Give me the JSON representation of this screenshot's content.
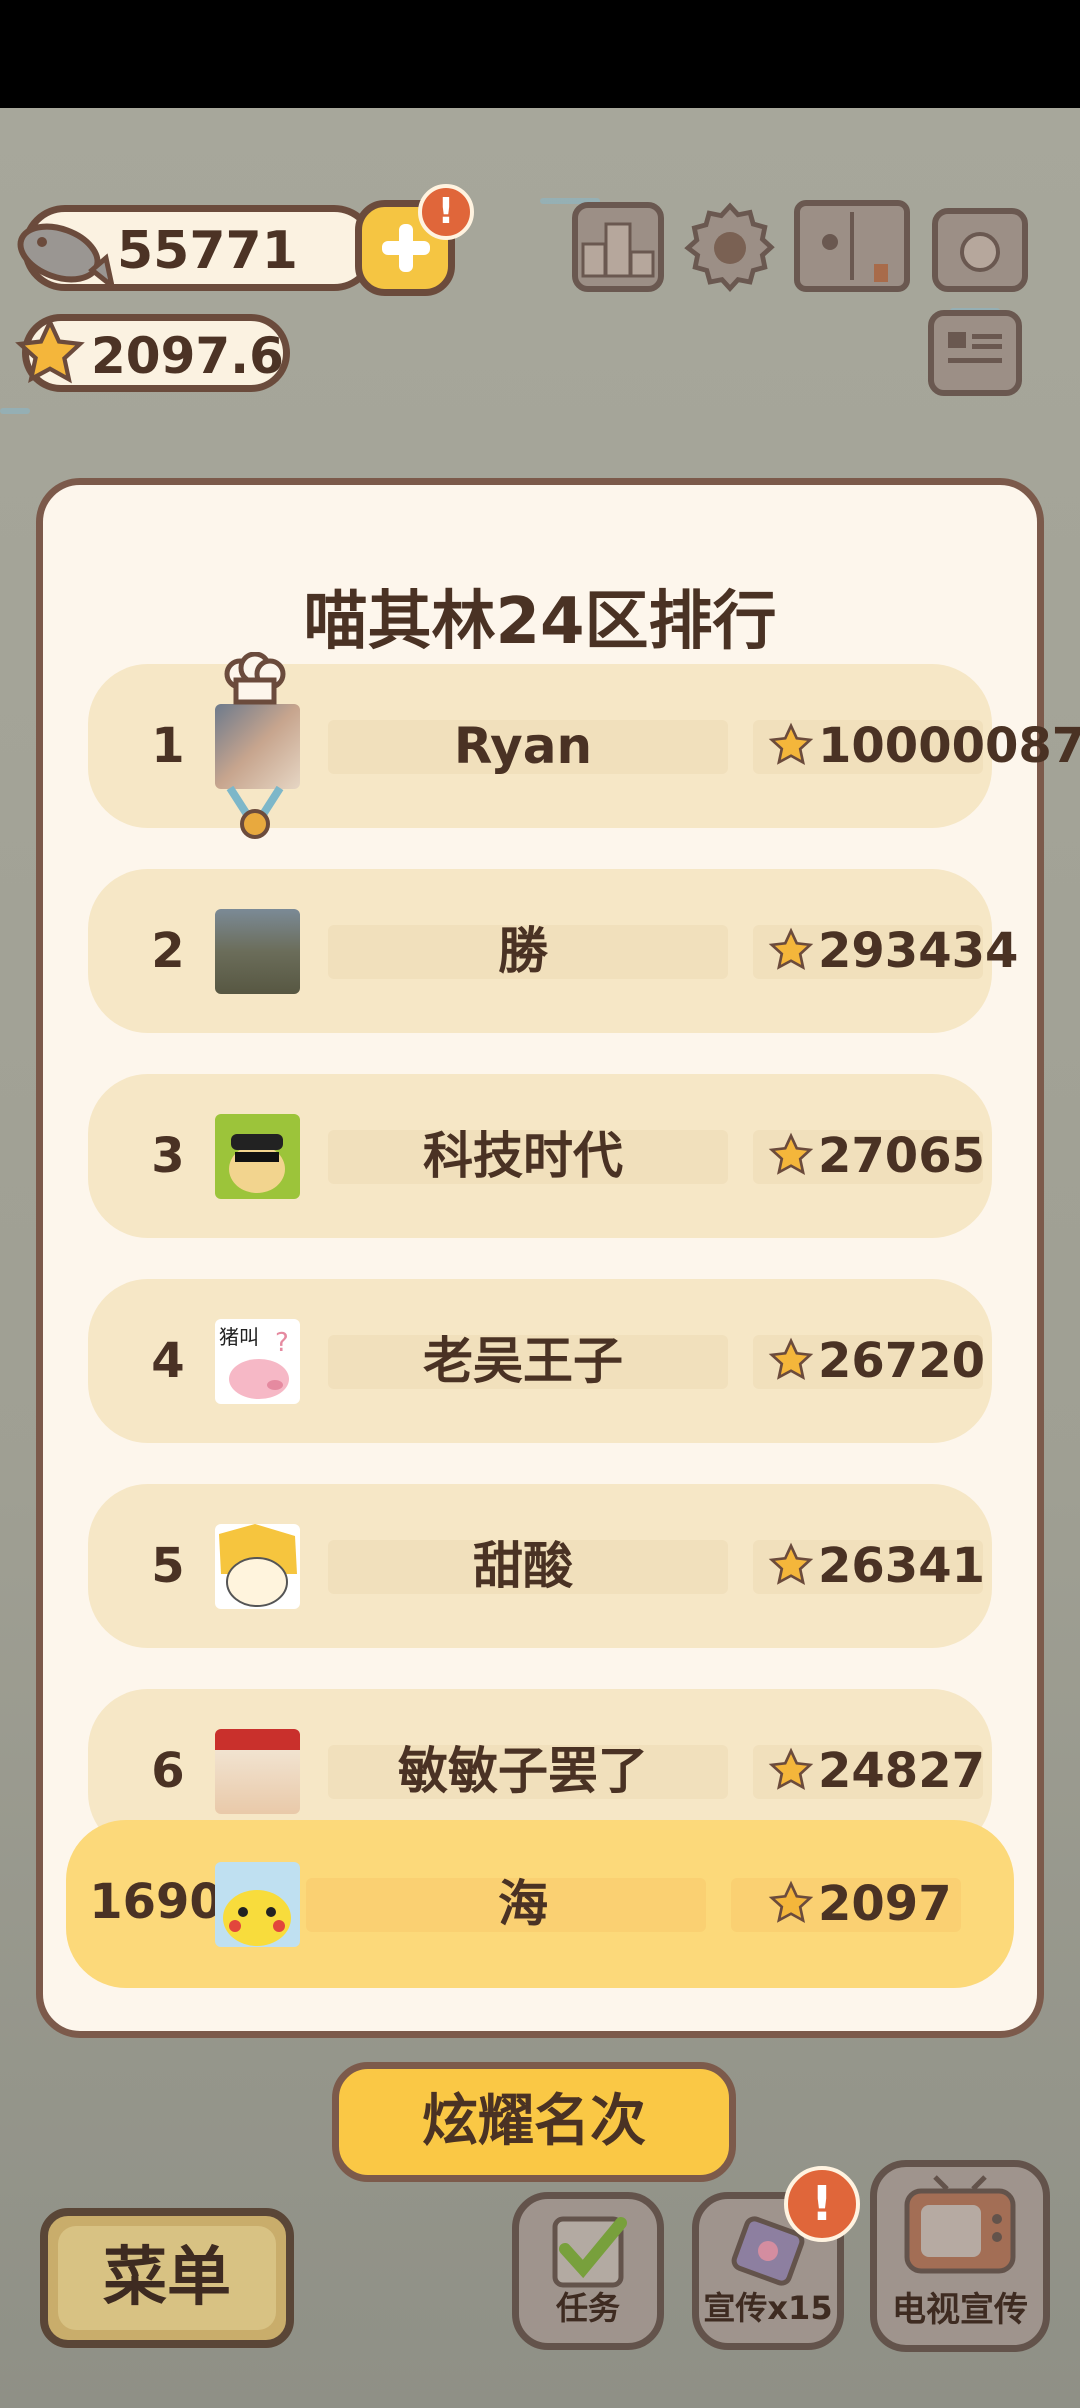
{
  "currency": {
    "fish": "55771",
    "stars": "2097.6",
    "plus_badge": "!"
  },
  "leaderboard": {
    "title": "喵其林24区排行",
    "rows": [
      {
        "rank": "1",
        "name": "Ryan",
        "score": "10000087"
      },
      {
        "rank": "2",
        "name": "勝",
        "score": "293434"
      },
      {
        "rank": "3",
        "name": "科技时代",
        "score": "27065"
      },
      {
        "rank": "4",
        "name": "老吴王子",
        "score": "26720"
      },
      {
        "rank": "5",
        "name": "甜酸",
        "score": "26341"
      },
      {
        "rank": "6",
        "name": "敏敏子罢了",
        "score": "24827"
      }
    ],
    "me": {
      "rank": "1690",
      "name": "海",
      "score": "2097"
    },
    "avatar4_text": "猪叫"
  },
  "buttons": {
    "show_rank": "炫耀名次",
    "menu": "菜单",
    "tasks": "任务",
    "promote": "宣传x15",
    "tv_promote": "电视宣传",
    "promote_badge": "!"
  },
  "colors": {
    "accent": "#fac845",
    "panel": "#fdf6ec",
    "row": "#f6e7c6",
    "my_row": "#fcd97a",
    "border": "#7c5a4b",
    "alert": "#e0663a"
  },
  "icons": [
    "fish-icon",
    "star-icon",
    "plus-icon",
    "ranking-icon",
    "settings-gear-icon",
    "recipe-book-icon",
    "camera-icon",
    "newspaper-icon",
    "check-icon",
    "ticket-icon",
    "tv-icon",
    "chef-hat-icon",
    "medal-icon"
  ]
}
